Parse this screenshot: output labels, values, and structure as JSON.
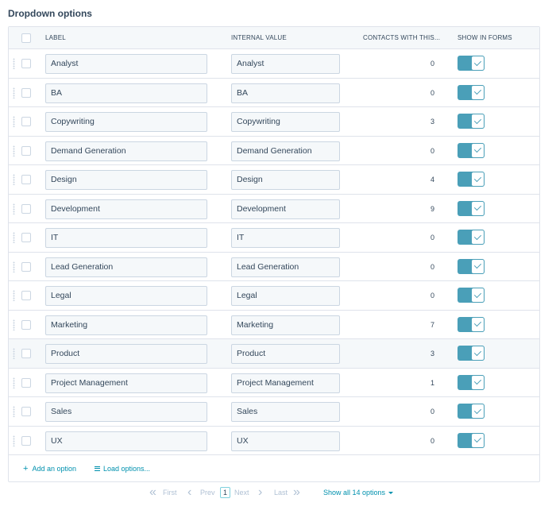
{
  "section": {
    "title": "Dropdown options"
  },
  "columns": {
    "label": "LABEL",
    "internal": "INTERNAL VALUE",
    "contacts": "CONTACTS WITH THIS...",
    "show": "SHOW IN FORMS"
  },
  "rows": [
    {
      "label": "Analyst",
      "internal": "Analyst",
      "count": "0",
      "show_in_forms": true
    },
    {
      "label": "BA",
      "internal": "BA",
      "count": "0",
      "show_in_forms": true
    },
    {
      "label": "Copywriting",
      "internal": "Copywriting",
      "count": "3",
      "show_in_forms": true
    },
    {
      "label": "Demand Generation",
      "internal": "Demand Generation",
      "count": "0",
      "show_in_forms": true
    },
    {
      "label": "Design",
      "internal": "Design",
      "count": "4",
      "show_in_forms": true
    },
    {
      "label": "Development",
      "internal": "Development",
      "count": "9",
      "show_in_forms": true
    },
    {
      "label": "IT",
      "internal": "IT",
      "count": "0",
      "show_in_forms": true
    },
    {
      "label": "Lead Generation",
      "internal": "Lead Generation",
      "count": "0",
      "show_in_forms": true
    },
    {
      "label": "Legal",
      "internal": "Legal",
      "count": "0",
      "show_in_forms": true
    },
    {
      "label": "Marketing",
      "internal": "Marketing",
      "count": "7",
      "show_in_forms": true
    },
    {
      "label": "Product",
      "internal": "Product",
      "count": "3",
      "show_in_forms": true
    },
    {
      "label": "Project Management",
      "internal": "Project Management",
      "count": "1",
      "show_in_forms": true
    },
    {
      "label": "Sales",
      "internal": "Sales",
      "count": "0",
      "show_in_forms": true
    },
    {
      "label": "UX",
      "internal": "UX",
      "count": "0",
      "show_in_forms": true
    }
  ],
  "highlighted_row": 10,
  "actions": {
    "add_option": "Add an option",
    "load_options": "Load options..."
  },
  "pagination": {
    "first": "First",
    "prev": "Prev",
    "current_page": "1",
    "next": "Next",
    "last": "Last",
    "show_all": "Show all 14 options"
  },
  "colors": {
    "accent": "#0091ae",
    "toggle_on": "#4a9fb8",
    "border": "#dfe3eb",
    "text": "#33475b"
  },
  "icons": {
    "add": "plus-icon",
    "load": "list-icon",
    "first": "double-chevron-left-icon",
    "prev": "chevron-left-icon",
    "next": "chevron-right-icon",
    "last": "double-chevron-right-icon",
    "show_all": "caret-down-icon",
    "toggle": "checkmark-icon"
  }
}
